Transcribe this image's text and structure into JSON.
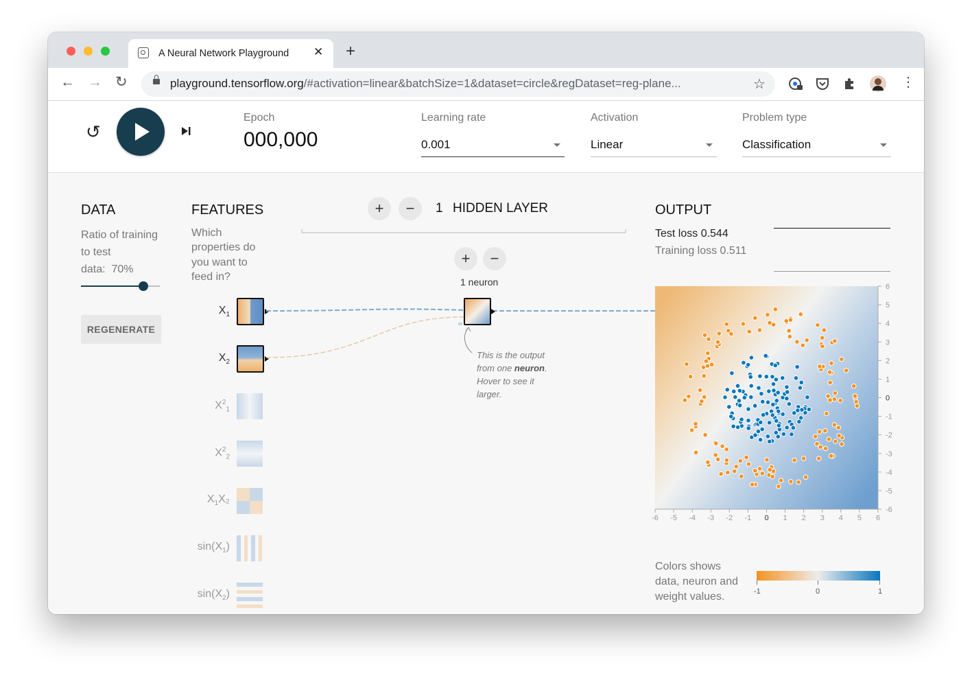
{
  "browser": {
    "tab_title": "A Neural Network Playground",
    "url_host": "playground.tensorflow.org",
    "url_rest": "/#activation=linear&batchSize=1&dataset=circle&regDataset=reg-plane..."
  },
  "controls": {
    "epoch_label": "Epoch",
    "epoch_value": "000,000",
    "learning_rate_label": "Learning rate",
    "learning_rate_value": "0.001",
    "activation_label": "Activation",
    "activation_value": "Linear",
    "problem_type_label": "Problem type",
    "problem_type_value": "Classification"
  },
  "data_panel": {
    "title": "DATA",
    "ratio_line1": "Ratio of training",
    "ratio_line2": "to test",
    "ratio_line3": "data:  70%",
    "ratio_fraction": 0.7,
    "regenerate_label": "REGENERATE"
  },
  "features_panel": {
    "title": "FEATURES",
    "question_lines": [
      "Which",
      "properties do",
      "you want to",
      "feed in?"
    ],
    "features": [
      {
        "base": "X",
        "sub": "1",
        "sup": "",
        "rest": "",
        "active": true
      },
      {
        "base": "X",
        "sub": "2",
        "sup": "",
        "rest": "",
        "active": true
      },
      {
        "base": "X",
        "sub": "1",
        "sup": "2",
        "rest": "",
        "active": false
      },
      {
        "base": "X",
        "sub": "2",
        "sup": "2",
        "rest": "",
        "active": false
      },
      {
        "base": "X",
        "sub": "1",
        "sup": "",
        "rest": "X₂",
        "active": false
      },
      {
        "base": "sin(X",
        "sub": "1",
        "sup": "",
        "rest": ")",
        "active": false
      },
      {
        "base": "sin(X",
        "sub": "2",
        "sup": "",
        "rest": ")",
        "active": false
      }
    ]
  },
  "network": {
    "layer_count": "1",
    "layer_label": "HIDDEN LAYER",
    "neuron_label": "1 neuron",
    "note_line1": "This is the output",
    "note_line2a": "from one ",
    "note_line2b": "neuron",
    "note_line2c": ".",
    "note_line3": "Hover to see it",
    "note_line4": "larger."
  },
  "output_panel": {
    "title": "OUTPUT",
    "test_loss": "Test loss 0.544",
    "training_loss": "Training loss 0.511",
    "colors_note": [
      "Colors shows",
      "data, neuron and",
      "weight values."
    ],
    "legend_ticks": [
      "-1",
      "0",
      "1"
    ]
  },
  "colors": {
    "orange": "#f59322",
    "blue": "#0877bd",
    "dark_button": "#183d4e"
  },
  "chart_data": {
    "type": "scatter",
    "title": "",
    "xlabel": "",
    "ylabel": "",
    "xlim": [
      -6,
      6
    ],
    "ylim": [
      -6,
      6
    ],
    "x_ticks": [
      -6,
      -5,
      -4,
      -3,
      -2,
      -1,
      0,
      1,
      2,
      3,
      4,
      5,
      6
    ],
    "y_ticks": [
      6,
      5,
      4,
      3,
      2,
      1,
      0,
      -1,
      -2,
      -3,
      -4,
      -5,
      -6
    ],
    "inner_radius_max": 2.4,
    "outer_radius_range": [
      3.3,
      4.9
    ],
    "series": [
      {
        "color": "#0877bd",
        "count": 120
      },
      {
        "color": "#f59322",
        "count": 130
      }
    ]
  }
}
